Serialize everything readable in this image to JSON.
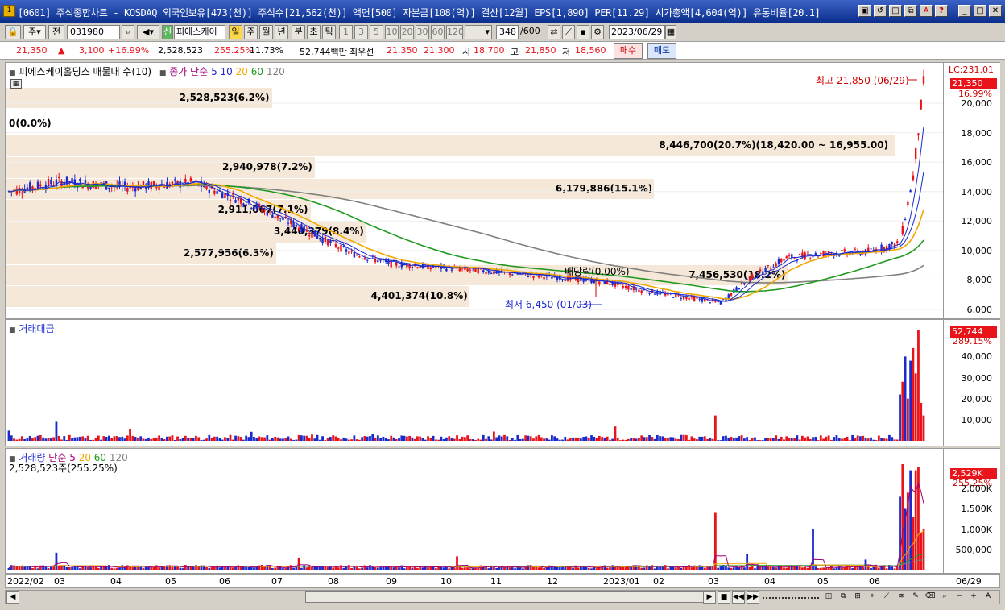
{
  "window": {
    "title": "[0601] 주식종합차트 - KOSDAQ 외국인보유[473(천)] 주식수[21,562(천)] 액면[500] 자본금[108(억)] 결산[12월] EPS[1,890] PER[11.29] 시가총액[4,604(억)] 유통비율[20.1]",
    "icon": "window-app-icon",
    "buttons": [
      "restore",
      "return",
      "window",
      "detach",
      "font",
      "help",
      "minimize",
      "maximize",
      "close"
    ]
  },
  "toolbar": {
    "market": "주",
    "all_label": "전",
    "code": "031980",
    "new_label": "신",
    "name": "피에스케이",
    "periods": [
      "일",
      "주",
      "월",
      "년",
      "분",
      "초",
      "틱"
    ],
    "active_period": "일",
    "counts": [
      "1",
      "3",
      "5",
      "10",
      "20",
      "30",
      "60",
      "120"
    ],
    "bars": "348",
    "bars_total": "/600",
    "date": "2023/06/29"
  },
  "quote": {
    "price": "21,350",
    "change": "3,100",
    "change_pct": "+16.99%",
    "volume": "2,528,523",
    "vol_ratio": "255.25%",
    "turnover": "11.73%",
    "amount": "52,744백만",
    "priority_label": "최우선",
    "ask": "21,350",
    "bid": "21,300",
    "open_label": "시",
    "open": "18,700",
    "high_label": "고",
    "high": "21,850",
    "low_label": "저",
    "low": "18,560",
    "buy": "매수",
    "sell": "매도"
  },
  "price_panel": {
    "legend_title": "피에스케이홀딩스 매물대 수(10)",
    "legend_ma": "종가 단순",
    "ma_periods": [
      "5",
      "10",
      "20",
      "60",
      "120"
    ],
    "volume_profile": [
      {
        "label": "2,528,523(6.2%)",
        "pct": 6.2
      },
      {
        "label": "0(0.0%)",
        "pct": 0.0
      },
      {
        "label": "8,446,700(20.7%)(18,420.00 ~ 16,955.00)",
        "pct": 20.7
      },
      {
        "label": "2,940,978(7.2%)",
        "pct": 7.2
      },
      {
        "label": "6,179,886(15.1%)",
        "pct": 15.1
      },
      {
        "label": "2,911,067(7.1%)",
        "pct": 7.1
      },
      {
        "label": "3,440,379(8.4%)",
        "pct": 8.4
      },
      {
        "label": "2,577,956(6.3%)",
        "pct": 6.3
      },
      {
        "label": "7,456,530(18.2%)",
        "pct": 18.2
      },
      {
        "label": "4,401,374(10.8%)",
        "pct": 10.8
      }
    ],
    "high_label": "최고 21,850 (06/29)",
    "low_label": "최저 6,450 (01/03)",
    "dividend_label": "배당락(0.00%)",
    "axis_labels": [
      "20,000",
      "18,000",
      "16,000",
      "14,000",
      "12,000",
      "10,000",
      "8,000",
      "6,000"
    ],
    "lc_label": "LC:231.01",
    "price_tag": "21,350",
    "pct_tag": "16.99%"
  },
  "amount_panel": {
    "legend": "거래대금",
    "axis_labels": [
      "40,000",
      "30,000",
      "20,000",
      "10,000"
    ],
    "tag": "52,744",
    "pct_tag": "289.15%"
  },
  "volume_panel": {
    "legend_title": "거래량",
    "legend_ma": "단순",
    "ma_periods": [
      "5",
      "20",
      "60",
      "120"
    ],
    "sub": "2,528,523주(255.25%)",
    "axis_labels": [
      "2,000K",
      "1,500K",
      "1,000K",
      "500,000"
    ],
    "tag": "2,529K",
    "pct_tag": "255.25%"
  },
  "xaxis": {
    "labels": [
      "2022/02",
      "03",
      "04",
      "05",
      "06",
      "07",
      "08",
      "09",
      "10",
      "11",
      "12",
      "2023/01",
      "02",
      "03",
      "04",
      "05",
      "06"
    ],
    "right_label": "06/29"
  },
  "colors": {
    "up": "#e8141a",
    "down": "#1a2acd",
    "ma5": "#1a2acd",
    "ma10": "#1a2acd",
    "ma20": "#f0a800",
    "ma60": "#1f9a1f",
    "ma120": "#808080",
    "vp": "#f6e7d6"
  },
  "chart_data": {
    "type": "candlestick",
    "title": "피에스케이홀딩스",
    "x_range": [
      "2022/02",
      "2023/06/29"
    ],
    "y_range": [
      6000,
      22000
    ],
    "last": {
      "date": "06/29",
      "open": 18700,
      "high": 21850,
      "low": 18560,
      "close": 21350
    },
    "period_low": {
      "date": "01/03",
      "value": 6450
    },
    "period_high": {
      "date": "06/29",
      "value": 21850
    }
  }
}
